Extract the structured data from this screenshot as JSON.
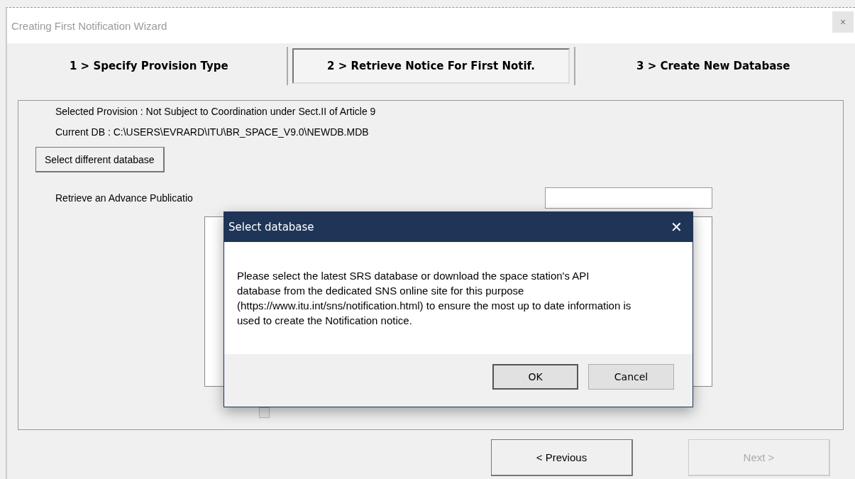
{
  "window": {
    "title": "Creating First Notification Wizard",
    "close": "×"
  },
  "steps": [
    {
      "label": "1 > Specify Provision Type",
      "selected": false
    },
    {
      "label": "2 > Retrieve Notice For First Notif.",
      "selected": true
    },
    {
      "label": "3 > Create New Database",
      "selected": false
    }
  ],
  "provision": "Selected Provision : Not Subject to Coordination under Sect.II of Article 9",
  "current_db": "Current DB : C:\\USERS\\EVRARD\\ITU\\BR_SPACE_V9.0\\NEWDB.MDB",
  "select_db_button": "Select different database",
  "retrieve_label": "Retrieve an Advance Publicatio",
  "exclude_checkbox": {
    "checked": false,
    "disabled": true
  },
  "buttons": [
    {
      "label": "< Previous",
      "disabled": false
    },
    {
      "label": "Next >",
      "disabled": true
    }
  ],
  "dialog": {
    "title": "Select database",
    "close": "✕",
    "message": "Please select the latest SRS database or download the space station's API database from the dedicated SNS online site for this purpose (https://www.itu.int/sns/notification.html) to ensure the most up to date information is used to create the Notification notice.",
    "buttons": [
      "OK",
      "Cancel"
    ]
  }
}
